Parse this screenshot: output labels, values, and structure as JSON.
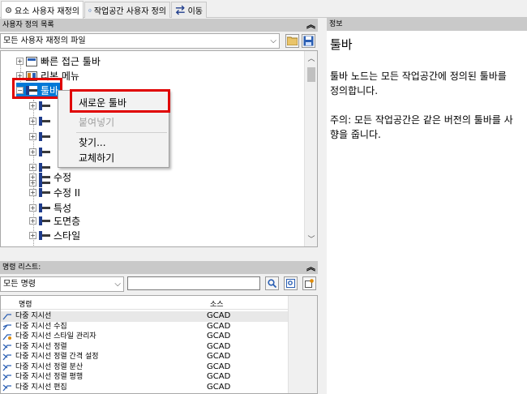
{
  "tabs": [
    {
      "label": "요소 사용자 재정의",
      "icon": "gear-icon"
    },
    {
      "label": "작업공간 사용자 정의",
      "icon": "home-icon"
    },
    {
      "label": "이동",
      "icon": "transfer-icon"
    }
  ],
  "customizations": {
    "header": "사용자 정의 목록",
    "file_select": "모든 사용자 재정의 파일"
  },
  "tree": {
    "items": [
      {
        "label": "빠른 접근 툴바",
        "level": 1
      },
      {
        "label": "리본 메뉴",
        "level": 1
      },
      {
        "label": "툴바",
        "level": 1
      },
      {
        "label": "",
        "level": 2
      },
      {
        "label": "",
        "level": 2
      },
      {
        "label": "",
        "level": 2
      },
      {
        "label": "",
        "level": 2
      },
      {
        "label": "",
        "level": 2
      },
      {
        "label": "",
        "level": 2
      },
      {
        "label": "수정",
        "level": 2
      },
      {
        "label": "수정 II",
        "level": 2
      },
      {
        "label": "특성",
        "level": 2
      },
      {
        "label": "도면층",
        "level": 2
      },
      {
        "label": "스타일",
        "level": 2
      }
    ]
  },
  "context_menu": {
    "new_toolbar": "새로운 툴바",
    "paste": "붙여넣기",
    "find": "찾기...",
    "replace": "교체하기"
  },
  "commands": {
    "header": "명령 리스트:",
    "filter_select": "모든 명령",
    "search_value": "",
    "columns": {
      "name": "명령",
      "source": "소스"
    },
    "rows": [
      {
        "name": "다중 지시선",
        "source": "GCAD"
      },
      {
        "name": "다중 지시선 수집",
        "source": "GCAD"
      },
      {
        "name": "다중 지시선 스타일 관리자",
        "source": "GCAD"
      },
      {
        "name": "다중 지시선 정렬",
        "source": "GCAD"
      },
      {
        "name": "다중 지시선 정렬 간격 설정",
        "source": "GCAD"
      },
      {
        "name": "다중 지시선 정렬 분산",
        "source": "GCAD"
      },
      {
        "name": "다중 지시선 정렬 평행",
        "source": "GCAD"
      },
      {
        "name": "다중 지시선 편집",
        "source": "GCAD"
      }
    ]
  },
  "info": {
    "header": "정보",
    "title": "툴바",
    "p1_line1": "툴바 노드는 모든 작업공간에 정의된 툴바를",
    "p1_line2": "정의합니다.",
    "p2_line1": "주의: 모든 작업공간은 같은 버전의 툴바를 사",
    "p2_line2": "향을 줍니다."
  },
  "colors": {
    "highlight": "#e00000",
    "selection": "#0078d7",
    "header_bg": "#c9c9c9"
  }
}
